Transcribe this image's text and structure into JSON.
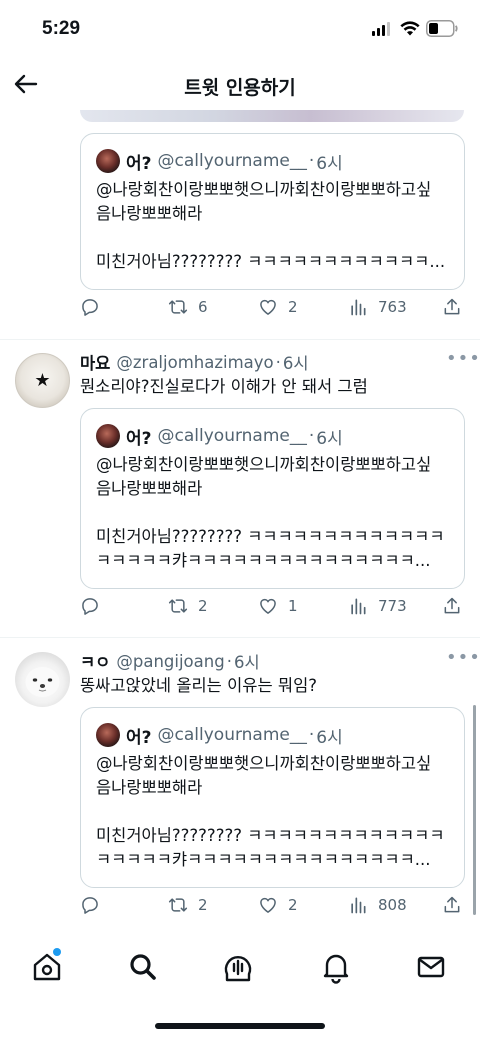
{
  "status": {
    "time": "5:29"
  },
  "header": {
    "title": "트윗 인용하기"
  },
  "top_fragment": {
    "quote": {
      "name": "어?",
      "handle": "@callyourname__",
      "sep": "·",
      "time": "6시",
      "lines": [
        "@나랑회찬이랑뽀뽀햇으니까회찬이랑뽀뽀하고싶",
        "음나랑뽀뽀해라",
        "미친거아님???????? ㅋㅋㅋㅋㅋㅋㅋㅋㅋㅋㅋㅋ..."
      ]
    },
    "stats": {
      "retweets": "6",
      "likes": "2",
      "views": "763"
    }
  },
  "tweets": [
    {
      "name": "마요",
      "handle": "@zraljomhazimayo",
      "sep": "·",
      "time": "6시",
      "text": "뭔소리야?진실로다가 이해가 안 돼서 그럼",
      "avatar_icon": "star-plate-avatar",
      "quote": {
        "name": "어?",
        "handle": "@callyourname__",
        "sep": "·",
        "time": "6시",
        "lines": [
          "@나랑회찬이랑뽀뽀햇으니까회찬이랑뽀뽀하고싶",
          "음나랑뽀뽀해라",
          "미친거아님???????? ㅋㅋㅋㅋㅋㅋㅋㅋㅋㅋㅋㅋㅋ",
          "ㅋㅋㅋㅋㅋ캬ㅋㅋㅋㅋㅋㅋㅋㅋㅋㅋㅋㅋㅋㅋㅋ..."
        ]
      },
      "stats": {
        "retweets": "2",
        "likes": "1",
        "views": "773"
      }
    },
    {
      "name": "ㅋㅇ",
      "handle": "@pangijoang",
      "sep": "·",
      "time": "6시",
      "text": "똥싸고앉았네 올리는 이유는 뭐임?",
      "avatar_icon": "white-dog-avatar",
      "quote": {
        "name": "어?",
        "handle": "@callyourname__",
        "sep": "·",
        "time": "6시",
        "lines": [
          "@나랑회찬이랑뽀뽀햇으니까회찬이랑뽀뽀하고싶",
          "음나랑뽀뽀해라",
          "미친거아님???????? ㅋㅋㅋㅋㅋㅋㅋㅋㅋㅋㅋㅋㅋ",
          "ㅋㅋㅋㅋㅋ캬ㅋㅋㅋㅋㅋㅋㅋㅋㅋㅋㅋㅋㅋㅋㅋ..."
        ]
      },
      "stats": {
        "retweets": "2",
        "likes": "2",
        "views": "808"
      }
    }
  ],
  "colors": {
    "accent": "#1d9bf0",
    "text": "#0f1419",
    "muted": "#536471",
    "border": "#cfd9de"
  },
  "tab_bar": {
    "items": [
      "home-icon",
      "search-icon",
      "spaces-icon",
      "notifications-icon",
      "messages-icon"
    ]
  }
}
